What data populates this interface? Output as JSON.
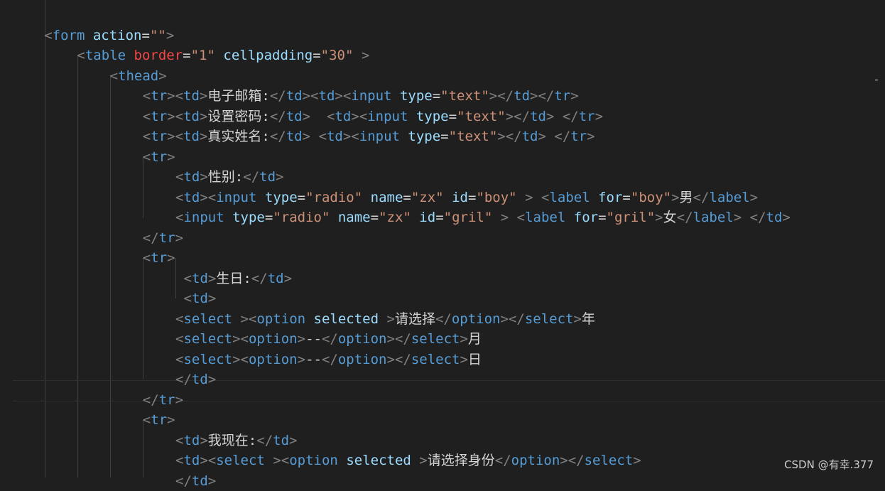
{
  "editor": {
    "lines": [
      {
        "indent": 0,
        "tokens": []
      },
      {
        "indent": 1,
        "tokens": [
          [
            "b",
            "<"
          ],
          [
            "t",
            "form"
          ],
          [
            "x",
            " "
          ],
          [
            "a",
            "action"
          ],
          [
            "x",
            "="
          ],
          [
            "s",
            "\"\""
          ],
          [
            "b",
            ">"
          ]
        ]
      },
      {
        "indent": 2,
        "tokens": [
          [
            "b",
            "<"
          ],
          [
            "t",
            "table"
          ],
          [
            "x",
            " "
          ],
          [
            "r",
            "border"
          ],
          [
            "x",
            "="
          ],
          [
            "s",
            "\"1\""
          ],
          [
            "x",
            " "
          ],
          [
            "a",
            "cellpadding"
          ],
          [
            "x",
            "="
          ],
          [
            "s",
            "\"30\""
          ],
          [
            "x",
            " "
          ],
          [
            "b",
            ">"
          ]
        ]
      },
      {
        "indent": 3,
        "tokens": [
          [
            "b",
            "<"
          ],
          [
            "t",
            "thead"
          ],
          [
            "b",
            ">"
          ]
        ]
      },
      {
        "indent": 4,
        "tokens": [
          [
            "b",
            "<"
          ],
          [
            "t",
            "tr"
          ],
          [
            "b",
            "><"
          ],
          [
            "t",
            "td"
          ],
          [
            "b",
            ">"
          ],
          [
            "x",
            "电子邮箱:"
          ],
          [
            "b",
            "</"
          ],
          [
            "t",
            "td"
          ],
          [
            "b",
            "><"
          ],
          [
            "t",
            "td"
          ],
          [
            "b",
            "><"
          ],
          [
            "t",
            "input"
          ],
          [
            "x",
            " "
          ],
          [
            "a",
            "type"
          ],
          [
            "x",
            "="
          ],
          [
            "s",
            "\"text\""
          ],
          [
            "b",
            "></"
          ],
          [
            "t",
            "td"
          ],
          [
            "b",
            "></"
          ],
          [
            "t",
            "tr"
          ],
          [
            "b",
            ">"
          ]
        ]
      },
      {
        "indent": 4,
        "tokens": [
          [
            "b",
            "<"
          ],
          [
            "t",
            "tr"
          ],
          [
            "b",
            "><"
          ],
          [
            "t",
            "td"
          ],
          [
            "b",
            ">"
          ],
          [
            "x",
            "设置密码:"
          ],
          [
            "b",
            "</"
          ],
          [
            "t",
            "td"
          ],
          [
            "b",
            ">"
          ],
          [
            "x",
            "  "
          ],
          [
            "b",
            "<"
          ],
          [
            "t",
            "td"
          ],
          [
            "b",
            "><"
          ],
          [
            "t",
            "input"
          ],
          [
            "x",
            " "
          ],
          [
            "a",
            "type"
          ],
          [
            "x",
            "="
          ],
          [
            "s",
            "\"text\""
          ],
          [
            "b",
            "></"
          ],
          [
            "t",
            "td"
          ],
          [
            "b",
            ">"
          ],
          [
            "x",
            " "
          ],
          [
            "b",
            "</"
          ],
          [
            "t",
            "tr"
          ],
          [
            "b",
            ">"
          ]
        ]
      },
      {
        "indent": 4,
        "tokens": [
          [
            "b",
            "<"
          ],
          [
            "t",
            "tr"
          ],
          [
            "b",
            "><"
          ],
          [
            "t",
            "td"
          ],
          [
            "b",
            ">"
          ],
          [
            "x",
            "真实姓名:"
          ],
          [
            "b",
            "</"
          ],
          [
            "t",
            "td"
          ],
          [
            "b",
            ">"
          ],
          [
            "x",
            " "
          ],
          [
            "b",
            "<"
          ],
          [
            "t",
            "td"
          ],
          [
            "b",
            "><"
          ],
          [
            "t",
            "input"
          ],
          [
            "x",
            " "
          ],
          [
            "a",
            "type"
          ],
          [
            "x",
            "="
          ],
          [
            "s",
            "\"text\""
          ],
          [
            "b",
            "></"
          ],
          [
            "t",
            "td"
          ],
          [
            "b",
            ">"
          ],
          [
            "x",
            " "
          ],
          [
            "b",
            "</"
          ],
          [
            "t",
            "tr"
          ],
          [
            "b",
            ">"
          ]
        ]
      },
      {
        "indent": 4,
        "tokens": [
          [
            "b",
            "<"
          ],
          [
            "t",
            "tr"
          ],
          [
            "b",
            ">"
          ]
        ]
      },
      {
        "indent": 5,
        "tokens": [
          [
            "b",
            "<"
          ],
          [
            "t",
            "td"
          ],
          [
            "b",
            ">"
          ],
          [
            "x",
            "性别:"
          ],
          [
            "b",
            "</"
          ],
          [
            "t",
            "td"
          ],
          [
            "b",
            ">"
          ]
        ]
      },
      {
        "indent": 5,
        "tokens": [
          [
            "b",
            "<"
          ],
          [
            "t",
            "td"
          ],
          [
            "b",
            "><"
          ],
          [
            "t",
            "input"
          ],
          [
            "x",
            " "
          ],
          [
            "a",
            "type"
          ],
          [
            "x",
            "="
          ],
          [
            "s",
            "\"radio\""
          ],
          [
            "x",
            " "
          ],
          [
            "a",
            "name"
          ],
          [
            "x",
            "="
          ],
          [
            "s",
            "\"zx\""
          ],
          [
            "x",
            " "
          ],
          [
            "a",
            "id"
          ],
          [
            "x",
            "="
          ],
          [
            "s",
            "\"boy\""
          ],
          [
            "x",
            " "
          ],
          [
            "b",
            ">"
          ],
          [
            "x",
            " "
          ],
          [
            "b",
            "<"
          ],
          [
            "t",
            "label"
          ],
          [
            "x",
            " "
          ],
          [
            "a",
            "for"
          ],
          [
            "x",
            "="
          ],
          [
            "s",
            "\"boy\""
          ],
          [
            "b",
            ">"
          ],
          [
            "x",
            "男"
          ],
          [
            "b",
            "</"
          ],
          [
            "t",
            "label"
          ],
          [
            "b",
            ">"
          ]
        ]
      },
      {
        "indent": 5,
        "tokens": [
          [
            "b",
            "<"
          ],
          [
            "t",
            "input"
          ],
          [
            "x",
            " "
          ],
          [
            "a",
            "type"
          ],
          [
            "x",
            "="
          ],
          [
            "s",
            "\"radio\""
          ],
          [
            "x",
            " "
          ],
          [
            "a",
            "name"
          ],
          [
            "x",
            "="
          ],
          [
            "s",
            "\"zx\""
          ],
          [
            "x",
            " "
          ],
          [
            "a",
            "id"
          ],
          [
            "x",
            "="
          ],
          [
            "s",
            "\"gril\""
          ],
          [
            "x",
            " "
          ],
          [
            "b",
            ">"
          ],
          [
            "x",
            " "
          ],
          [
            "b",
            "<"
          ],
          [
            "t",
            "label"
          ],
          [
            "x",
            " "
          ],
          [
            "a",
            "for"
          ],
          [
            "x",
            "="
          ],
          [
            "s",
            "\"gril\""
          ],
          [
            "b",
            ">"
          ],
          [
            "x",
            "女"
          ],
          [
            "b",
            "</"
          ],
          [
            "t",
            "label"
          ],
          [
            "b",
            ">"
          ],
          [
            "x",
            " "
          ],
          [
            "b",
            "</"
          ],
          [
            "t",
            "td"
          ],
          [
            "b",
            ">"
          ]
        ]
      },
      {
        "indent": 4,
        "tokens": [
          [
            "b",
            "</"
          ],
          [
            "t",
            "tr"
          ],
          [
            "b",
            ">"
          ]
        ]
      },
      {
        "indent": 4,
        "tokens": [
          [
            "b",
            "<"
          ],
          [
            "t",
            "tr"
          ],
          [
            "b",
            ">"
          ]
        ]
      },
      {
        "indent": 5.25,
        "tokens": [
          [
            "b",
            "<"
          ],
          [
            "t",
            "td"
          ],
          [
            "b",
            ">"
          ],
          [
            "x",
            "生日:"
          ],
          [
            "b",
            "</"
          ],
          [
            "t",
            "td"
          ],
          [
            "b",
            ">"
          ]
        ]
      },
      {
        "indent": 5.25,
        "tokens": [
          [
            "b",
            "<"
          ],
          [
            "t",
            "td"
          ],
          [
            "b",
            ">"
          ]
        ]
      },
      {
        "indent": 5,
        "tokens": [
          [
            "b",
            "<"
          ],
          [
            "t",
            "select"
          ],
          [
            "x",
            " "
          ],
          [
            "b",
            "><"
          ],
          [
            "t",
            "option"
          ],
          [
            "x",
            " "
          ],
          [
            "a",
            "selected"
          ],
          [
            "x",
            " "
          ],
          [
            "b",
            ">"
          ],
          [
            "x",
            "请选择"
          ],
          [
            "b",
            "</"
          ],
          [
            "t",
            "option"
          ],
          [
            "b",
            "></"
          ],
          [
            "t",
            "select"
          ],
          [
            "b",
            ">"
          ],
          [
            "x",
            "年"
          ]
        ]
      },
      {
        "indent": 5,
        "tokens": [
          [
            "b",
            "<"
          ],
          [
            "t",
            "select"
          ],
          [
            "b",
            "><"
          ],
          [
            "t",
            "option"
          ],
          [
            "b",
            ">"
          ],
          [
            "x",
            "--"
          ],
          [
            "b",
            "</"
          ],
          [
            "t",
            "option"
          ],
          [
            "b",
            "></"
          ],
          [
            "t",
            "select"
          ],
          [
            "b",
            ">"
          ],
          [
            "x",
            "月"
          ]
        ]
      },
      {
        "indent": 5,
        "tokens": [
          [
            "b",
            "<"
          ],
          [
            "t",
            "select"
          ],
          [
            "b",
            "><"
          ],
          [
            "t",
            "option"
          ],
          [
            "b",
            ">"
          ],
          [
            "x",
            "--"
          ],
          [
            "b",
            "</"
          ],
          [
            "t",
            "option"
          ],
          [
            "b",
            "></"
          ],
          [
            "t",
            "select"
          ],
          [
            "b",
            ">"
          ],
          [
            "x",
            "日"
          ]
        ]
      },
      {
        "indent": 5,
        "tokens": [
          [
            "b",
            "</"
          ],
          [
            "t",
            "td"
          ],
          [
            "b",
            ">"
          ]
        ]
      },
      {
        "indent": 4,
        "tokens": [
          [
            "b",
            "</"
          ],
          [
            "t",
            "tr"
          ],
          [
            "b",
            ">"
          ]
        ]
      },
      {
        "indent": 4,
        "tokens": [
          [
            "b",
            "<"
          ],
          [
            "t",
            "tr"
          ],
          [
            "b",
            ">"
          ]
        ]
      },
      {
        "indent": 5,
        "tokens": [
          [
            "b",
            "<"
          ],
          [
            "t",
            "td"
          ],
          [
            "b",
            ">"
          ],
          [
            "x",
            "我现在:"
          ],
          [
            "b",
            "</"
          ],
          [
            "t",
            "td"
          ],
          [
            "b",
            ">"
          ]
        ]
      },
      {
        "indent": 5,
        "tokens": [
          [
            "b",
            "<"
          ],
          [
            "t",
            "td"
          ],
          [
            "b",
            "><"
          ],
          [
            "t",
            "select"
          ],
          [
            "x",
            " "
          ],
          [
            "b",
            "><"
          ],
          [
            "t",
            "option"
          ],
          [
            "x",
            " "
          ],
          [
            "a",
            "selected"
          ],
          [
            "x",
            " "
          ],
          [
            "b",
            ">"
          ],
          [
            "x",
            "请选择身份"
          ],
          [
            "b",
            "</"
          ],
          [
            "t",
            "option"
          ],
          [
            "b",
            "></"
          ],
          [
            "t",
            "select"
          ],
          [
            "b",
            ">"
          ]
        ]
      },
      {
        "indent": 5,
        "tokens": [
          [
            "b",
            "</"
          ],
          [
            "t",
            "td"
          ],
          [
            "b",
            ">"
          ]
        ]
      }
    ]
  },
  "watermark": "CSDN @有幸.377"
}
